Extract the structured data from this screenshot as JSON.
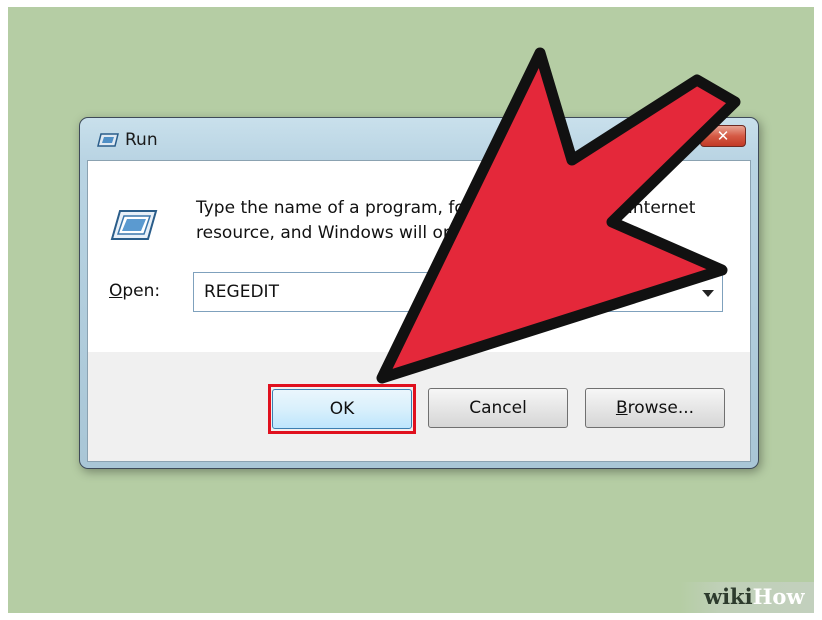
{
  "dialog": {
    "title": "Run",
    "close_glyph": "✕",
    "description": "Type the name of a program, folder, document, or Internet resource, and Windows will open it for you.",
    "open_label_mnemonic": "O",
    "open_label_rest": "pen:",
    "open_value": "REGEDIT",
    "buttons": {
      "ok": "OK",
      "cancel": "Cancel",
      "browse_mnemonic": "B",
      "browse_rest": "rowse..."
    }
  },
  "icons": {
    "title": "run-icon",
    "program": "run-program-icon",
    "dropdown": "chevron-down-icon",
    "pointer": "red-arrow-icon"
  },
  "colors": {
    "background": "#b5cda4",
    "highlight": "#e0101e",
    "arrow": "#e4283a"
  },
  "watermark": {
    "part1": "wiki",
    "part2": "How"
  }
}
